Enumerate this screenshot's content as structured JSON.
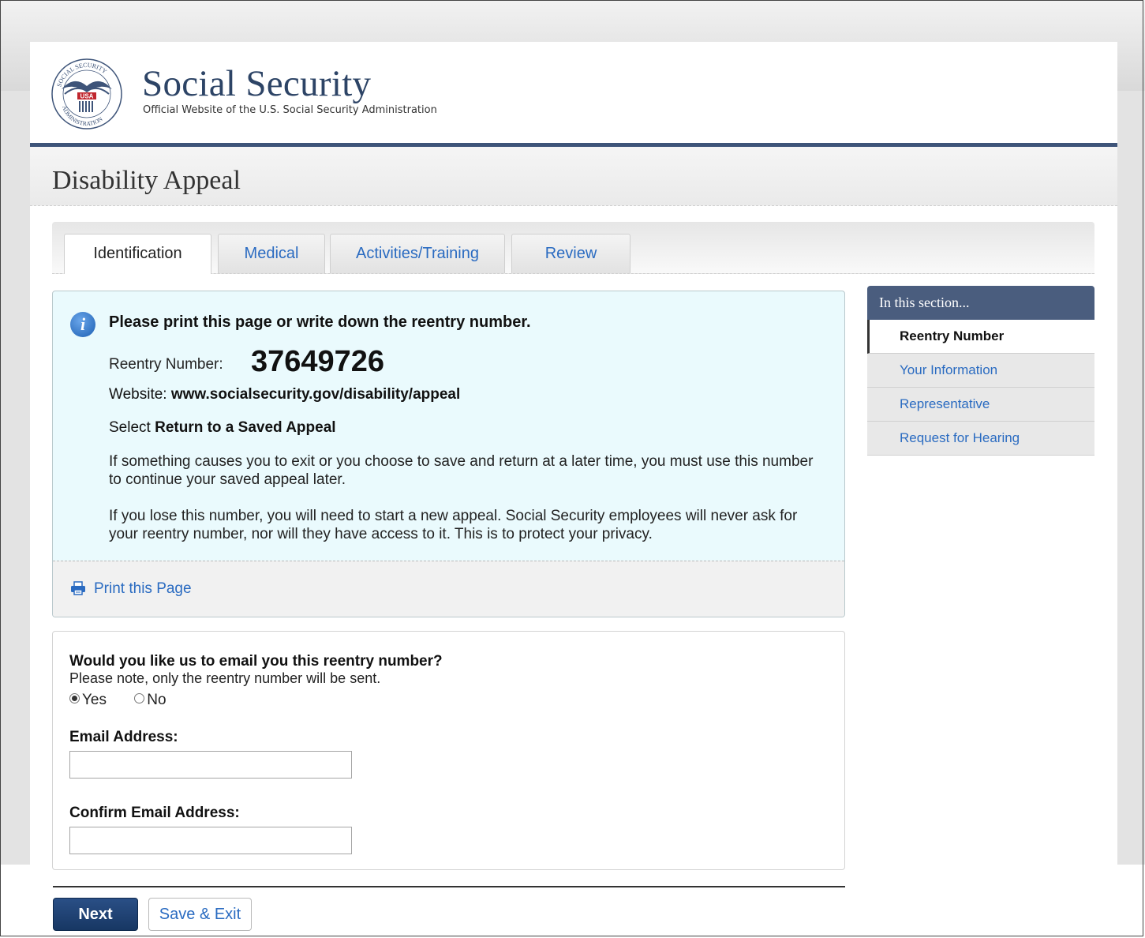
{
  "brand": {
    "title": "Social Security",
    "subtitle": "Official Website of the U.S. Social Security Administration",
    "seal_text_top": "SOCIAL SECURITY",
    "seal_text_bottom": "ADMINISTRATION",
    "seal_flag": "USA",
    "accent_color": "#3e5479"
  },
  "page": {
    "title": "Disability Appeal"
  },
  "tabs": [
    {
      "label": "Identification",
      "active": true
    },
    {
      "label": "Medical",
      "active": false
    },
    {
      "label": "Activities/Training",
      "active": false
    },
    {
      "label": "Review",
      "active": false
    }
  ],
  "info": {
    "icon": "info-icon",
    "heading": "Please print this page or write down the reentry number.",
    "reentry_label": "Reentry Number:",
    "reentry_number": "37649726",
    "website_label": "Website:",
    "website_url": "www.socialsecurity.gov/disability/appeal",
    "select_label": "Select",
    "select_value": "Return to a Saved Appeal",
    "para1": "If something causes you to exit or you choose to save and return at a later time, you must use this number to continue your saved appeal later.",
    "para2": "If you lose this number, you will need to start a new appeal. Social Security employees will never ask for your reentry number, nor will they have access to it. This is to protect your privacy.",
    "print_label": "Print this Page",
    "print_icon": "printer-icon"
  },
  "email": {
    "question": "Would you like us to email you this reentry number?",
    "note": "Please note, only the reentry number will be sent.",
    "options": [
      {
        "label": "Yes",
        "selected": true
      },
      {
        "label": "No",
        "selected": false
      }
    ],
    "email_label": "Email Address:",
    "email_value": "",
    "confirm_label": "Confirm Email Address:",
    "confirm_value": ""
  },
  "sidebar": {
    "title": "In this section...",
    "items": [
      {
        "label": "Reentry Number",
        "current": true
      },
      {
        "label": "Your Information",
        "current": false
      },
      {
        "label": "Representative",
        "current": false
      },
      {
        "label": "Request for Hearing",
        "current": false
      }
    ]
  },
  "buttons": {
    "next": "Next",
    "save_exit": "Save & Exit"
  }
}
